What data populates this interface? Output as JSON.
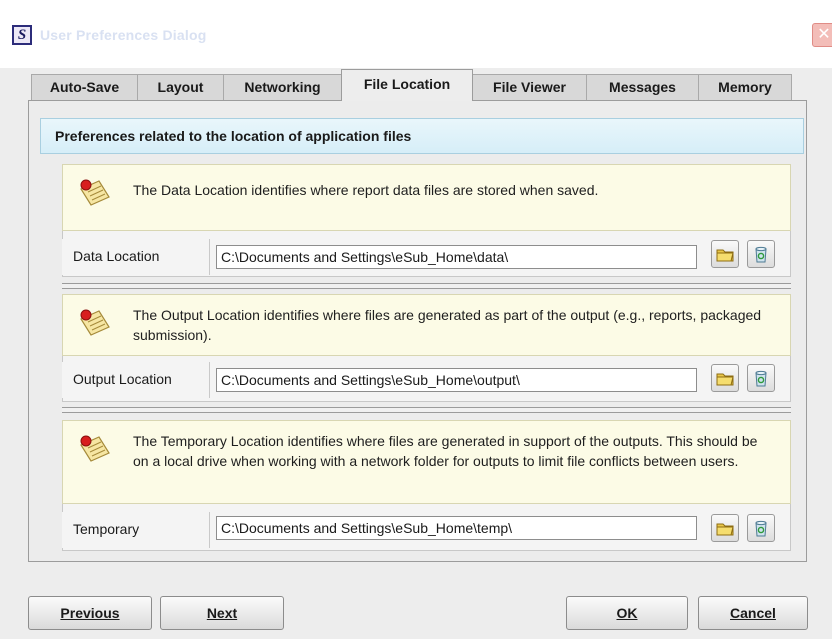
{
  "window": {
    "title": "User Preferences Dialog",
    "app_icon_letter": "S",
    "close_glyph": "✕"
  },
  "tabs": [
    {
      "label": "Auto-Save",
      "active": false
    },
    {
      "label": "Layout",
      "active": false
    },
    {
      "label": "Networking",
      "active": false
    },
    {
      "label": "File Location",
      "active": true
    },
    {
      "label": "File Viewer",
      "active": false
    },
    {
      "label": "Messages",
      "active": false
    },
    {
      "label": "Memory",
      "active": false
    }
  ],
  "panel": {
    "header": "Preferences related to the location of application files"
  },
  "sections": [
    {
      "description": "The Data Location identifies where report data files are stored when saved.",
      "label": "Data Location",
      "path": "C:\\Documents and Settings\\eSub_Home\\data\\",
      "browse_icon": "folder-icon",
      "clear_icon": "recycle-bin-icon"
    },
    {
      "description": "The Output Location identifies where files are generated as part of the output (e.g., reports, packaged submission).",
      "label": "Output Location",
      "path": "C:\\Documents and Settings\\eSub_Home\\output\\",
      "browse_icon": "folder-icon",
      "clear_icon": "recycle-bin-icon"
    },
    {
      "description": "The Temporary Location identifies where files are generated in support of the outputs. This should be on a local drive when working with a network folder for outputs to limit file conflicts between users.",
      "label": "Temporary",
      "path": "C:\\Documents and Settings\\eSub_Home\\temp\\",
      "browse_icon": "folder-icon",
      "clear_icon": "recycle-bin-icon"
    }
  ],
  "buttons": {
    "previous": "Previous",
    "next": "Next",
    "ok": "OK",
    "cancel": "Cancel"
  },
  "colors": {
    "header_bg": "#dff2fa",
    "info_bg": "#fcfbe6",
    "dialog_bg": "#ededed"
  }
}
